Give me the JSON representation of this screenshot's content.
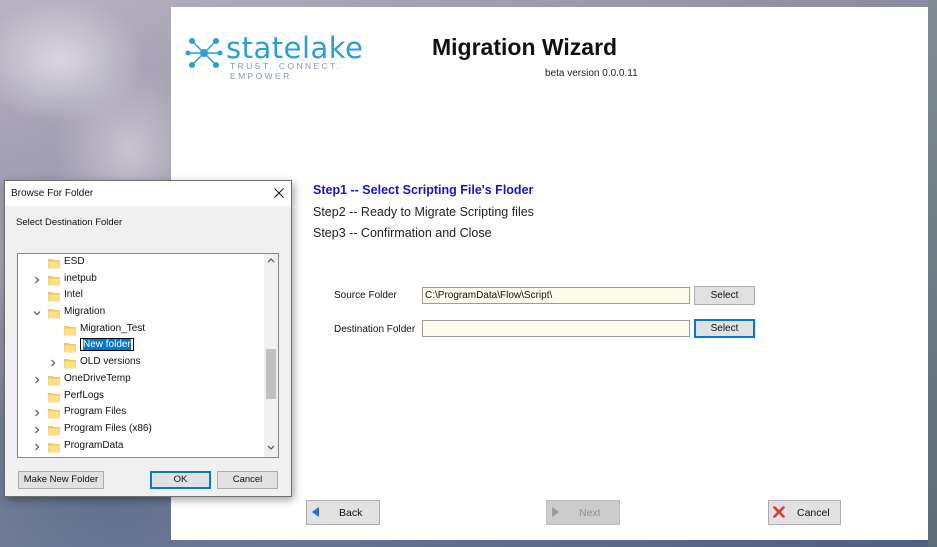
{
  "wizard": {
    "logo_word": "statelake",
    "logo_tagline": "TRUST. CONNECT. EMPOWER",
    "title": "Migration Wizard",
    "version": "beta version 0.0.0.11",
    "steps": [
      {
        "label": "Step1 -- Select Scripting File's Floder",
        "active": true
      },
      {
        "label": "Step2 -- Ready to Migrate Scripting files",
        "active": false
      },
      {
        "label": "Step3 -- Confirmation and Close",
        "active": false
      }
    ],
    "source": {
      "label": "Source Folder",
      "value": "C:\\ProgramData\\Flow\\Script\\",
      "button": "Select"
    },
    "destination": {
      "label": "Destination Folder",
      "value": "",
      "button": "Select"
    },
    "nav": {
      "back": "Back",
      "next": "Next",
      "cancel": "Cancel"
    },
    "colors": {
      "accent": "#1515d0",
      "logo": "#2a9fd6",
      "input_bg": "#fffbec"
    }
  },
  "dialog": {
    "title": "Browse For Folder",
    "instruction": "Select Destination Folder",
    "tree": [
      {
        "name": "ESD",
        "expander": "none",
        "depth": 0
      },
      {
        "name": "inetpub",
        "expander": "collapsed",
        "depth": 0
      },
      {
        "name": "Intel",
        "expander": "none",
        "depth": 0
      },
      {
        "name": "Migration",
        "expander": "expanded",
        "depth": 0
      },
      {
        "name": "Migration_Test",
        "expander": "none",
        "depth": 1
      },
      {
        "name": "New folder",
        "expander": "none",
        "depth": 1,
        "editing": true
      },
      {
        "name": "OLD versions",
        "expander": "collapsed",
        "depth": 1
      },
      {
        "name": "OneDriveTemp",
        "expander": "collapsed",
        "depth": 0
      },
      {
        "name": "PerfLogs",
        "expander": "none",
        "depth": 0
      },
      {
        "name": "Program Files",
        "expander": "collapsed",
        "depth": 0
      },
      {
        "name": "Program Files (x86)",
        "expander": "collapsed",
        "depth": 0
      },
      {
        "name": "ProgramData",
        "expander": "collapsed",
        "depth": 0
      }
    ],
    "buttons": {
      "make_new_folder": "Make New Folder",
      "ok": "OK",
      "cancel": "Cancel"
    },
    "icons": {
      "close": "close-icon",
      "folder": "folder-icon",
      "expand": "chevron-right-icon",
      "collapse": "chevron-down-icon"
    }
  }
}
